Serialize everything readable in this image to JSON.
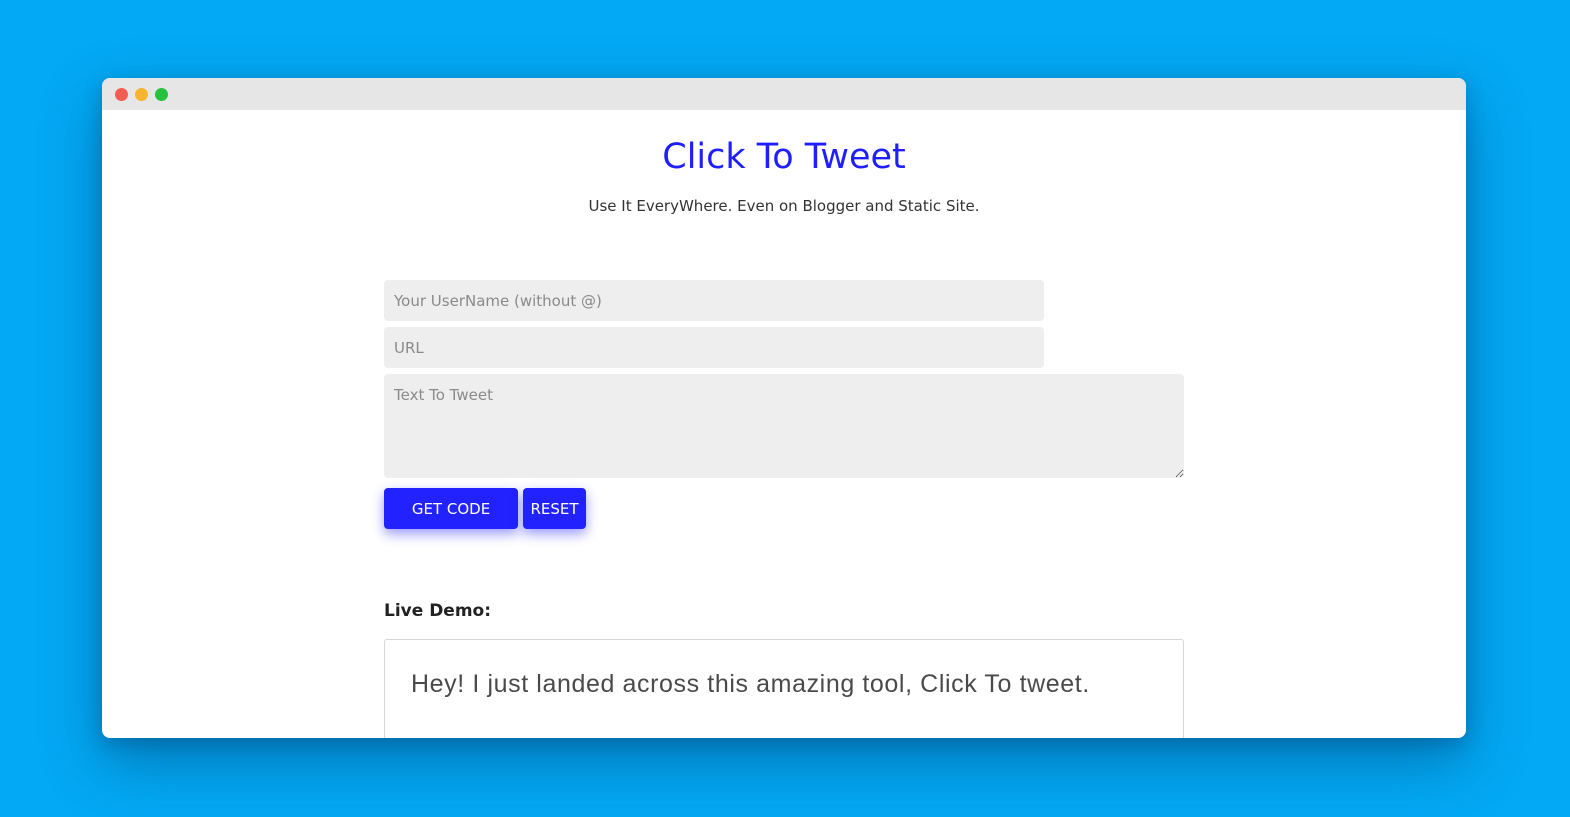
{
  "page": {
    "title": "Click To Tweet",
    "subtitle": "Use It EveryWhere. Even on Blogger and Static Site."
  },
  "form": {
    "username_placeholder": "Your UserName (without @)",
    "url_placeholder": "URL",
    "text_placeholder": "Text To Tweet",
    "get_code_label": "GET CODE",
    "reset_label": "RESET"
  },
  "demo": {
    "label": "Live Demo:",
    "text": "Hey! I just landed across this amazing tool, Click To tweet."
  },
  "colors": {
    "background": "#03a9f4",
    "accent": "#2222ff",
    "title": "#1e1eff"
  }
}
